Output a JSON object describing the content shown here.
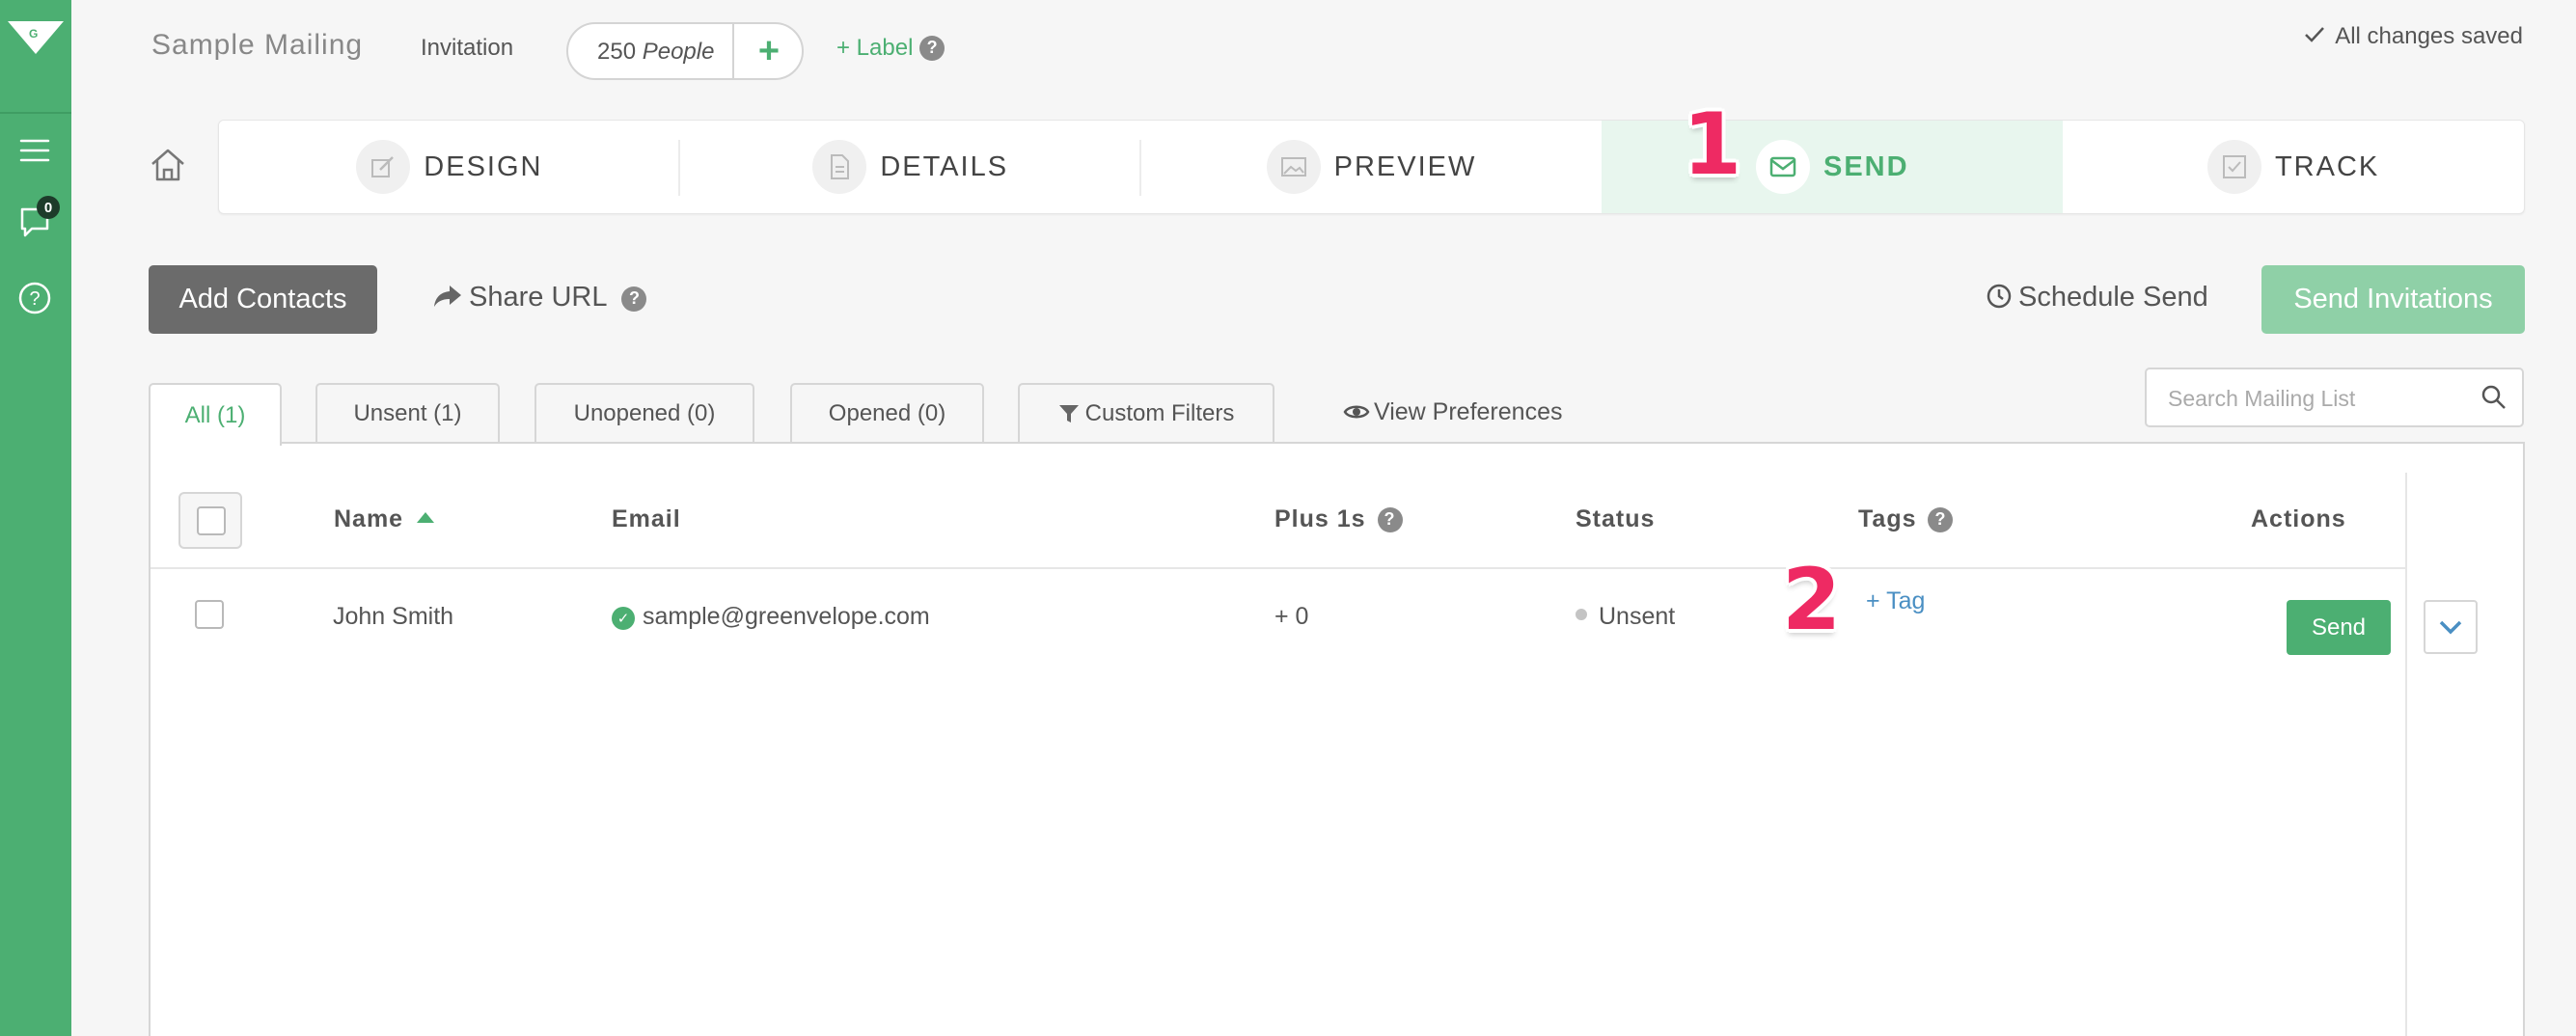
{
  "sidebar": {
    "badge_count": "0",
    "logo_letter": "G"
  },
  "header": {
    "title": "Sample Mailing",
    "type": "Invitation",
    "people_count": "250",
    "people_unit": "People",
    "add_label": "+ Label",
    "saved_status": "All changes saved"
  },
  "steps": [
    {
      "label": "DESIGN"
    },
    {
      "label": "DETAILS"
    },
    {
      "label": "PREVIEW"
    },
    {
      "label": "SEND",
      "active": true
    },
    {
      "label": "TRACK"
    }
  ],
  "callouts": {
    "first": "1",
    "second": "2"
  },
  "actions": {
    "add_contacts": "Add Contacts",
    "share_url": "Share URL",
    "schedule_send": "Schedule Send",
    "send_invitations": "Send Invitations"
  },
  "tabs": [
    {
      "label": "All (1)"
    },
    {
      "label": "Unsent (1)"
    },
    {
      "label": "Unopened (0)"
    },
    {
      "label": "Opened (0)"
    },
    {
      "label": "Custom Filters"
    }
  ],
  "view_preferences": "View Preferences",
  "search": {
    "placeholder": "Search Mailing List"
  },
  "table": {
    "columns": {
      "name": "Name",
      "email": "Email",
      "plus": "Plus 1s",
      "status": "Status",
      "tags": "Tags",
      "actions": "Actions"
    },
    "rows": [
      {
        "name": "John Smith",
        "email": "sample@greenvelope.com",
        "plus": "+ 0",
        "status": "Unsent",
        "add_tag": "+ Tag",
        "action": "Send"
      }
    ]
  },
  "colors": {
    "brand_green": "#4caf72",
    "callout_pink": "#ee2a63",
    "link_blue": "#4a8fc3"
  },
  "icons": [
    "logo-icon",
    "menu-icon",
    "chat-icon",
    "help-icon",
    "home-icon",
    "pencil-icon",
    "document-icon",
    "image-icon",
    "envelope-icon",
    "checkbox-icon",
    "share-icon",
    "clock-icon",
    "filter-icon",
    "eye-icon",
    "search-icon",
    "check-icon",
    "chevron-down-icon"
  ]
}
